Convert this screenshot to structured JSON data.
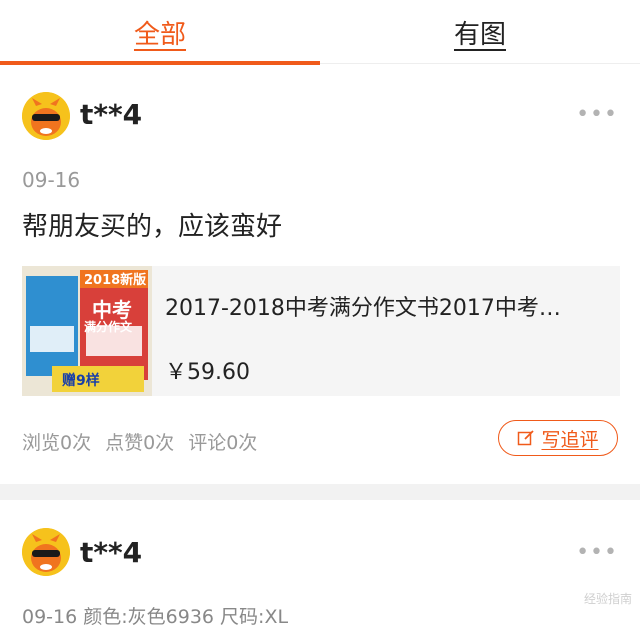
{
  "tabs": [
    {
      "label": "全部",
      "active": true
    },
    {
      "label": "有图",
      "active": false
    }
  ],
  "colors": {
    "accent": "#f05a1a",
    "separator": "#f2f2f2"
  },
  "reviews": [
    {
      "avatar_icon": "mascot-avatar-icon",
      "username": "t**4",
      "more": "•••",
      "date": "09-16",
      "content": "帮朋友买的，应该蛮好",
      "product": {
        "title": "2017-2018中考满分作文书2017中考…",
        "price": "￥59.60",
        "thumb_badge": "2018新版",
        "thumb_main": "中考",
        "thumb_sub": "满分作文",
        "thumb_gift": "赠9样"
      },
      "stats": {
        "views": "浏览0次",
        "likes": "点赞0次",
        "comments": "评论0次"
      },
      "write_button": "写追评"
    },
    {
      "avatar_icon": "mascot-avatar-icon",
      "username": "t**4",
      "more": "•••",
      "date": "09-16 颜色:灰色6936 尺码:XL"
    }
  ],
  "watermark": "经验指南"
}
